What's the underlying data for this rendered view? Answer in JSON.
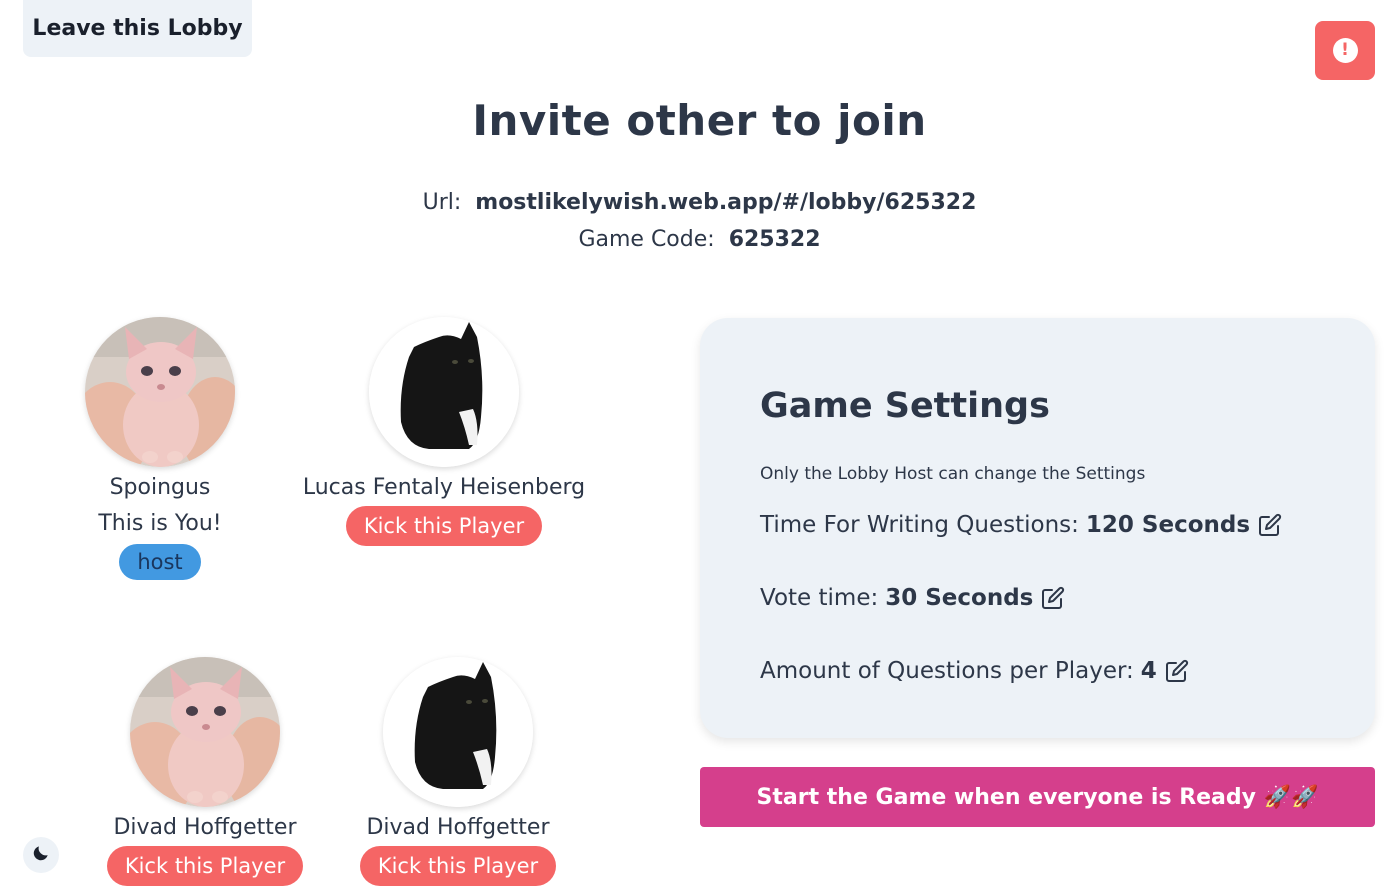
{
  "header": {
    "leave_label": "Leave this Lobby",
    "alert_glyph": "!",
    "alert_icon": "exclamation-circle-icon"
  },
  "invite": {
    "title": "Invite other to join",
    "url_label": "Url:",
    "url_value": "mostlikelywish.web.app/#/lobby/625322",
    "code_label": "Game Code:",
    "code_value": "625322"
  },
  "players": [
    {
      "name": "Spoingus",
      "you_label": "This is You!",
      "badge": "host",
      "avatar": "sphynx-cat"
    },
    {
      "name": "Lucas Fentaly Heisenberg",
      "kick_label": "Kick this Player",
      "avatar": "black-cat"
    },
    {
      "name": "Divad Hoffgetter",
      "kick_label": "Kick this Player",
      "avatar": "sphynx-cat"
    },
    {
      "name": "Divad Hoffgetter",
      "kick_label": "Kick this Player",
      "avatar": "black-cat"
    }
  ],
  "settings": {
    "title": "Game Settings",
    "note": "Only the Lobby Host can change the Settings",
    "writing_label": "Time For Writing Questions:",
    "writing_value": "120 Seconds",
    "vote_label": "Vote time:",
    "vote_value": "30 Seconds",
    "questions_label": "Amount of Questions per Player:",
    "questions_value": "4"
  },
  "start_label": "Start the Game when everyone is Ready 🚀🚀",
  "colors": {
    "accent_pink": "#d53f8c",
    "danger_red": "#f56565",
    "host_blue": "#4299e1",
    "card_bg": "#edf2f7"
  }
}
